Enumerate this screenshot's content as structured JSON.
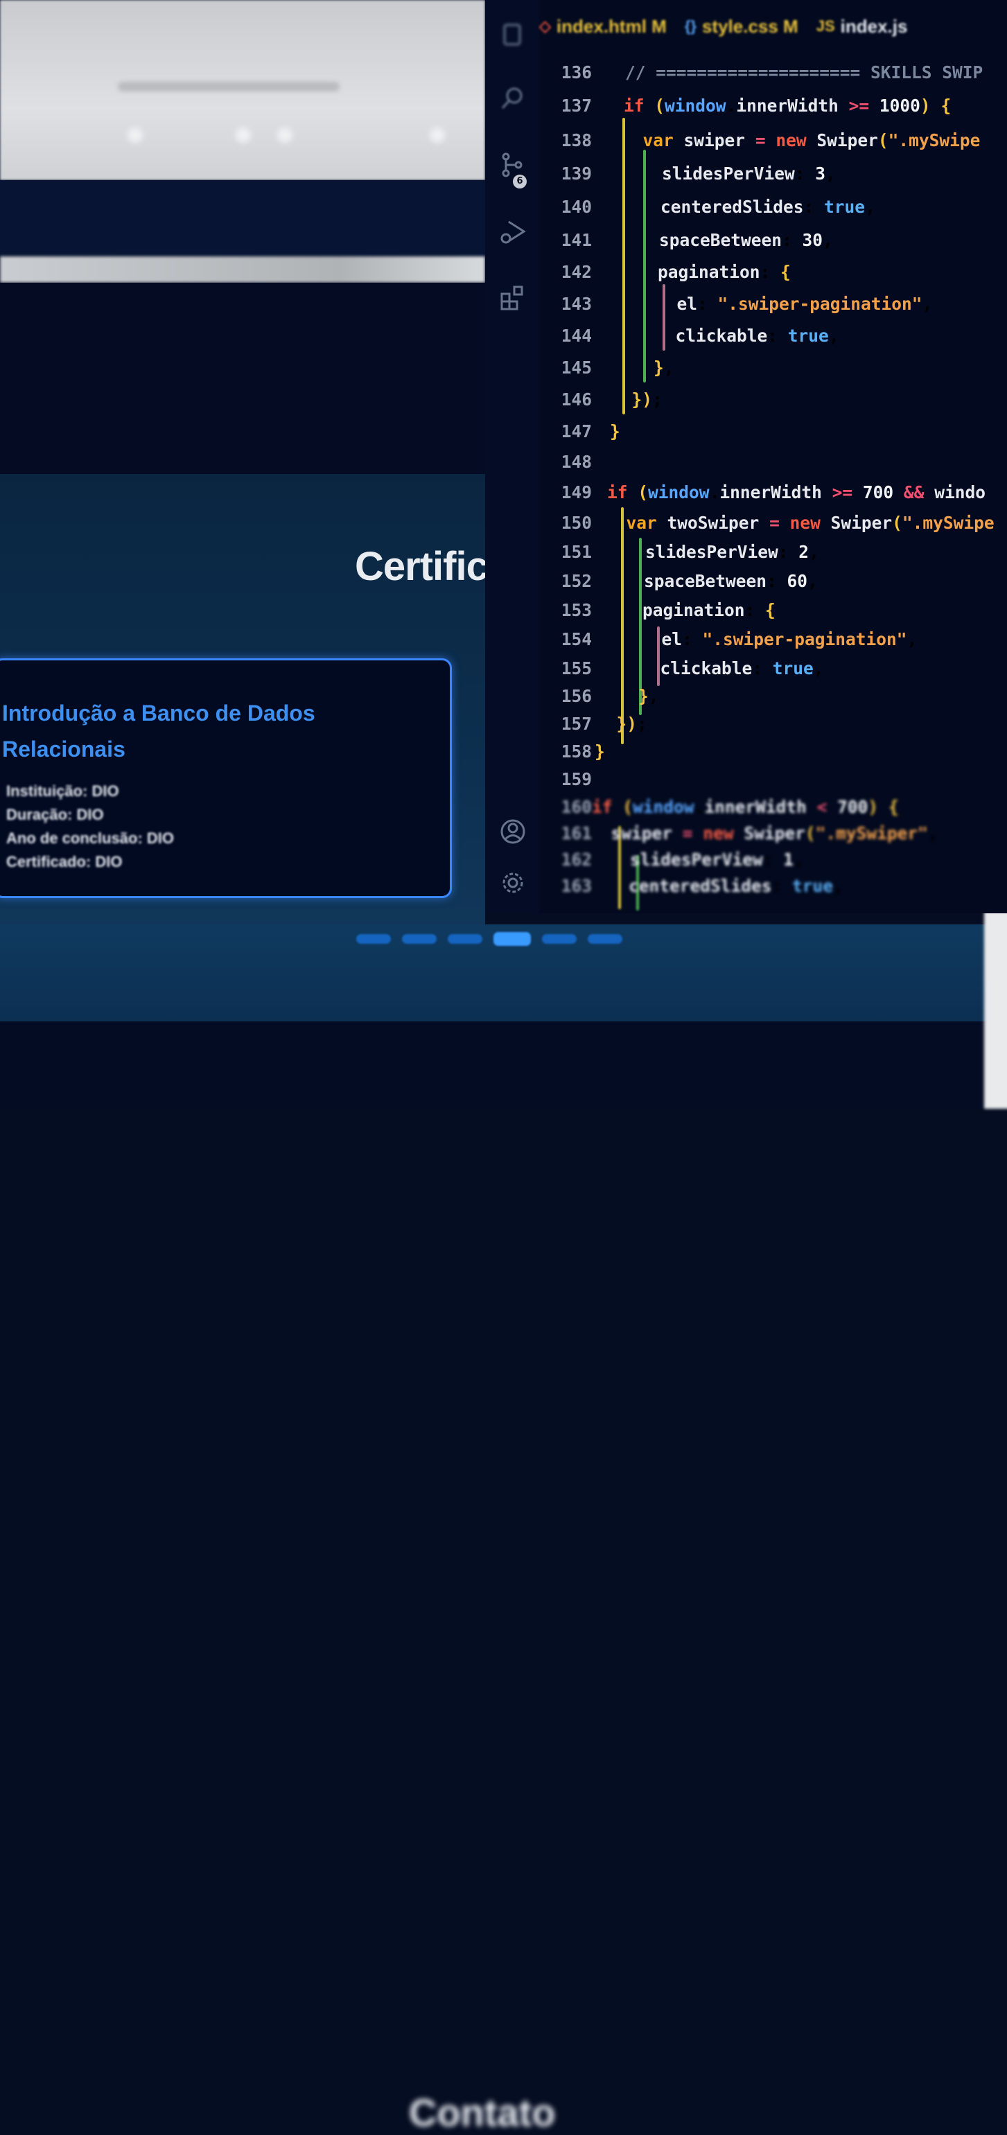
{
  "browser": {
    "section_title": "Certific",
    "card": {
      "title": "Introdução a Banco de Dados Relacionais",
      "lines": [
        "Instituição: DIO",
        "Duração: DIO",
        "Ano de conclusão: DIO",
        "Certificado: DIO"
      ]
    },
    "pagination_count": 6,
    "pagination_active": 4,
    "footer_title": "Contato"
  },
  "editor": {
    "tabs": [
      {
        "icon": "html-icon",
        "glyph": "◇",
        "label": "index.html M",
        "color": "#e8503a"
      },
      {
        "icon": "css-icon",
        "glyph": "{}",
        "label": "style.css M",
        "color": "#5aa4f5"
      },
      {
        "icon": "js-icon",
        "glyph": "JS",
        "label": "index.js",
        "color": "#e8c03a"
      }
    ],
    "source_control_badge": "6",
    "lines": [
      {
        "n": "136",
        "code": "// ==================== SKILLS SWIP"
      },
      {
        "n": "137",
        "code": "if (window.innerWidth >= 1000) {"
      },
      {
        "n": "138",
        "code": "  var swiper = new Swiper(\".mySwipe"
      },
      {
        "n": "139",
        "code": "    slidesPerView: 3,"
      },
      {
        "n": "140",
        "code": "    centeredSlides: true,"
      },
      {
        "n": "141",
        "code": "    spaceBetween: 30,"
      },
      {
        "n": "142",
        "code": "    pagination: {"
      },
      {
        "n": "143",
        "code": "      el: \".swiper-pagination\","
      },
      {
        "n": "144",
        "code": "      clickable: true,"
      },
      {
        "n": "145",
        "code": "    },"
      },
      {
        "n": "146",
        "code": "  });"
      },
      {
        "n": "147",
        "code": "}"
      },
      {
        "n": "148",
        "code": ""
      },
      {
        "n": "149",
        "code": "if (window.innerWidth >= 700 && windo"
      },
      {
        "n": "150",
        "code": "  var twoSwiper = new Swiper(\".mySwipe"
      },
      {
        "n": "151",
        "code": "    slidesPerView: 2,"
      },
      {
        "n": "152",
        "code": "    spaceBetween: 60,"
      },
      {
        "n": "153",
        "code": "    pagination: {"
      },
      {
        "n": "154",
        "code": "      el: \".swiper-pagination\","
      },
      {
        "n": "155",
        "code": "      clickable: true,"
      },
      {
        "n": "156",
        "code": "    },"
      },
      {
        "n": "157",
        "code": "  });"
      },
      {
        "n": "158",
        "code": "}"
      },
      {
        "n": "159",
        "code": ""
      },
      {
        "n": "160",
        "code": "if (window.innerWidth < 700) {"
      },
      {
        "n": "161",
        "code": "  swiper = new Swiper(\".mySwiper\","
      },
      {
        "n": "162",
        "code": "    slidesPerView: 1,"
      },
      {
        "n": "163",
        "code": "    centeredSlides: true,"
      }
    ]
  }
}
